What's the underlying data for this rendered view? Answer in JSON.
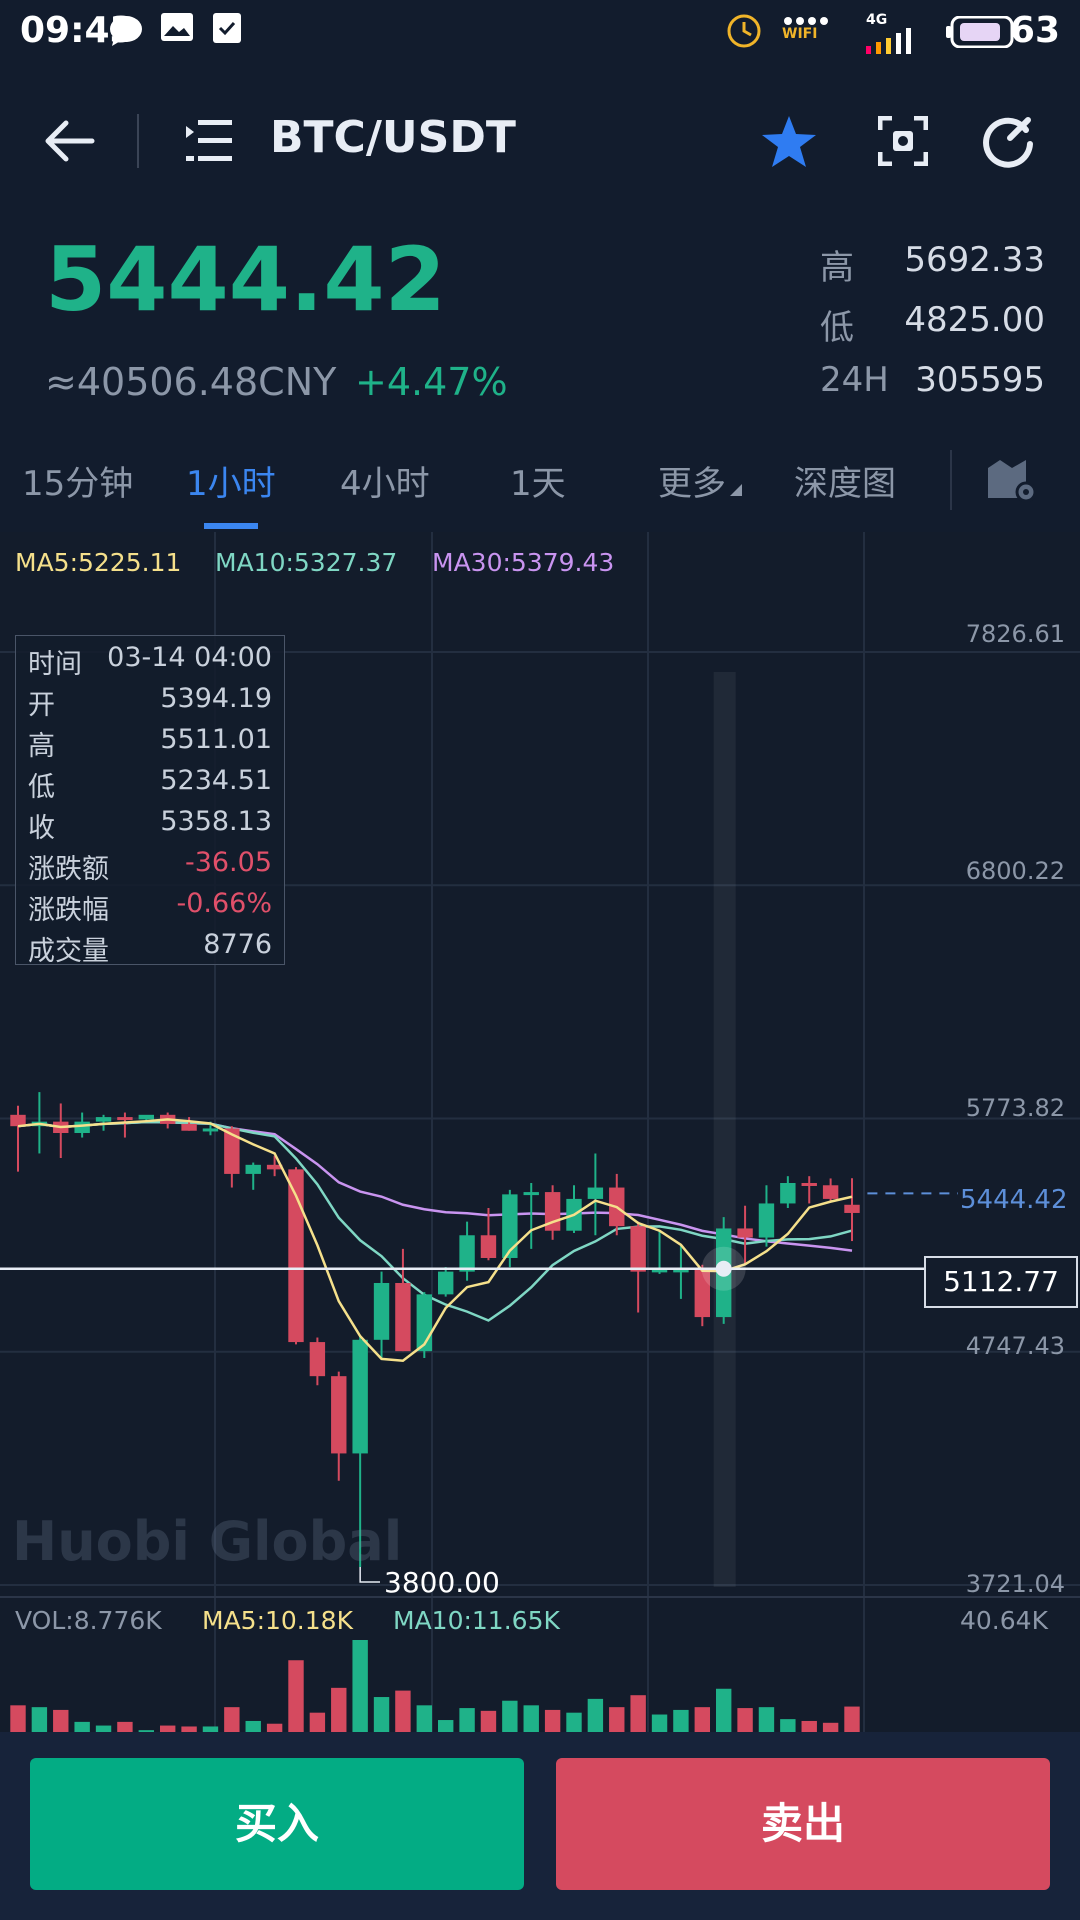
{
  "status_bar": {
    "time": "09:43",
    "battery": "63",
    "network": "4G",
    "wifi_label": "WIFI"
  },
  "header": {
    "pair": "BTC/USDT",
    "icons": [
      "back-arrow-icon",
      "menu-list-icon",
      "star-icon",
      "scan-icon",
      "refresh-icon"
    ]
  },
  "ticker": {
    "price": "5444.42",
    "cny": "≈40506.48CNY",
    "change_pct": "+4.47%",
    "high_label": "高",
    "high": "5692.33",
    "low_label": "低",
    "low": "4825.00",
    "vol_label": "24H",
    "vol24h": "305595"
  },
  "tabs": [
    "15分钟",
    "1小时",
    "4小时",
    "1天",
    "更多",
    "深度图"
  ],
  "active_tab": "1小时",
  "ma_legend": {
    "ma5": "MA5:5225.11",
    "ma10": "MA10:5327.37",
    "ma30": "MA30:5379.43"
  },
  "y_axis": [
    "7826.61",
    "6800.22",
    "5773.82",
    "4747.43",
    "3721.04"
  ],
  "last_price_tag": "5444.42",
  "crosshair_price": "5112.77",
  "low_marker": "3800.00",
  "watermark": "Huobi Global",
  "tooltip": {
    "rows": [
      {
        "k": "时间",
        "v": "03-14 04:00"
      },
      {
        "k": "开",
        "v": "5394.19"
      },
      {
        "k": "高",
        "v": "5511.01"
      },
      {
        "k": "低",
        "v": "5234.51"
      },
      {
        "k": "收",
        "v": "5358.13"
      },
      {
        "k": "涨跌额",
        "v": "-36.05"
      },
      {
        "k": "涨跌幅",
        "v": "-0.66%"
      },
      {
        "k": "成交量",
        "v": "8776"
      }
    ]
  },
  "volume": {
    "vol": "VOL:8.776K",
    "ma5": "MA5:10.18K",
    "ma10": "MA10:11.65K",
    "max": "40.64K"
  },
  "actions": {
    "buy": "买入",
    "sell": "卖出"
  },
  "colors": {
    "up": "#1fb289",
    "down": "#d54a5f",
    "accent": "#3b86f0",
    "ma5": "#f5e08b",
    "ma10": "#7fd7c4",
    "ma30": "#c994f0"
  },
  "chart_data": {
    "type": "candlestick",
    "candles": [
      {
        "o": 5790,
        "h": 5830,
        "l": 5540,
        "c": 5740
      },
      {
        "o": 5740,
        "h": 5890,
        "l": 5620,
        "c": 5760
      },
      {
        "o": 5760,
        "h": 5840,
        "l": 5600,
        "c": 5710
      },
      {
        "o": 5710,
        "h": 5800,
        "l": 5690,
        "c": 5760
      },
      {
        "o": 5760,
        "h": 5790,
        "l": 5720,
        "c": 5780
      },
      {
        "o": 5780,
        "h": 5800,
        "l": 5690,
        "c": 5770
      },
      {
        "o": 5770,
        "h": 5780,
        "l": 5760,
        "c": 5790
      },
      {
        "o": 5790,
        "h": 5800,
        "l": 5730,
        "c": 5750
      },
      {
        "o": 5750,
        "h": 5780,
        "l": 5720,
        "c": 5720
      },
      {
        "o": 5720,
        "h": 5760,
        "l": 5700,
        "c": 5730
      },
      {
        "o": 5730,
        "h": 5740,
        "l": 5470,
        "c": 5530
      },
      {
        "o": 5530,
        "h": 5580,
        "l": 5460,
        "c": 5570
      },
      {
        "o": 5570,
        "h": 5610,
        "l": 5520,
        "c": 5550
      },
      {
        "o": 5550,
        "h": 5560,
        "l": 4780,
        "c": 4790
      },
      {
        "o": 4790,
        "h": 4810,
        "l": 4600,
        "c": 4640
      },
      {
        "o": 4640,
        "h": 4660,
        "l": 4180,
        "c": 4300
      },
      {
        "o": 4300,
        "h": 4820,
        "l": 3800,
        "c": 4800
      },
      {
        "o": 4800,
        "h": 5100,
        "l": 4720,
        "c": 5050
      },
      {
        "o": 5050,
        "h": 5200,
        "l": 4750,
        "c": 4750
      },
      {
        "o": 4750,
        "h": 5010,
        "l": 4720,
        "c": 5000
      },
      {
        "o": 5000,
        "h": 5120,
        "l": 4990,
        "c": 5100
      },
      {
        "o": 5100,
        "h": 5320,
        "l": 5060,
        "c": 5260
      },
      {
        "o": 5260,
        "h": 5380,
        "l": 5150,
        "c": 5160
      },
      {
        "o": 5160,
        "h": 5460,
        "l": 5120,
        "c": 5440
      },
      {
        "o": 5440,
        "h": 5490,
        "l": 5200,
        "c": 5450
      },
      {
        "o": 5450,
        "h": 5480,
        "l": 5240,
        "c": 5280
      },
      {
        "o": 5280,
        "h": 5480,
        "l": 5270,
        "c": 5420
      },
      {
        "o": 5420,
        "h": 5620,
        "l": 5260,
        "c": 5470
      },
      {
        "o": 5470,
        "h": 5530,
        "l": 5260,
        "c": 5300
      },
      {
        "o": 5300,
        "h": 5320,
        "l": 4920,
        "c": 5100
      },
      {
        "o": 5100,
        "h": 5280,
        "l": 5090,
        "c": 5110
      },
      {
        "o": 5110,
        "h": 5220,
        "l": 4980,
        "c": 5110
      },
      {
        "o": 5110,
        "h": 5130,
        "l": 4860,
        "c": 4900
      },
      {
        "o": 4900,
        "h": 5340,
        "l": 4870,
        "c": 5290
      },
      {
        "o": 5290,
        "h": 5390,
        "l": 5130,
        "c": 5250
      },
      {
        "o": 5250,
        "h": 5480,
        "l": 5210,
        "c": 5400
      },
      {
        "o": 5400,
        "h": 5520,
        "l": 5380,
        "c": 5490
      },
      {
        "o": 5490,
        "h": 5520,
        "l": 5400,
        "c": 5480
      },
      {
        "o": 5480,
        "h": 5510,
        "l": 5410,
        "c": 5420
      },
      {
        "o": 5394.19,
        "h": 5511.01,
        "l": 5234.51,
        "c": 5358.13
      }
    ],
    "ylim": [
      3721.04,
      7826.61
    ]
  }
}
